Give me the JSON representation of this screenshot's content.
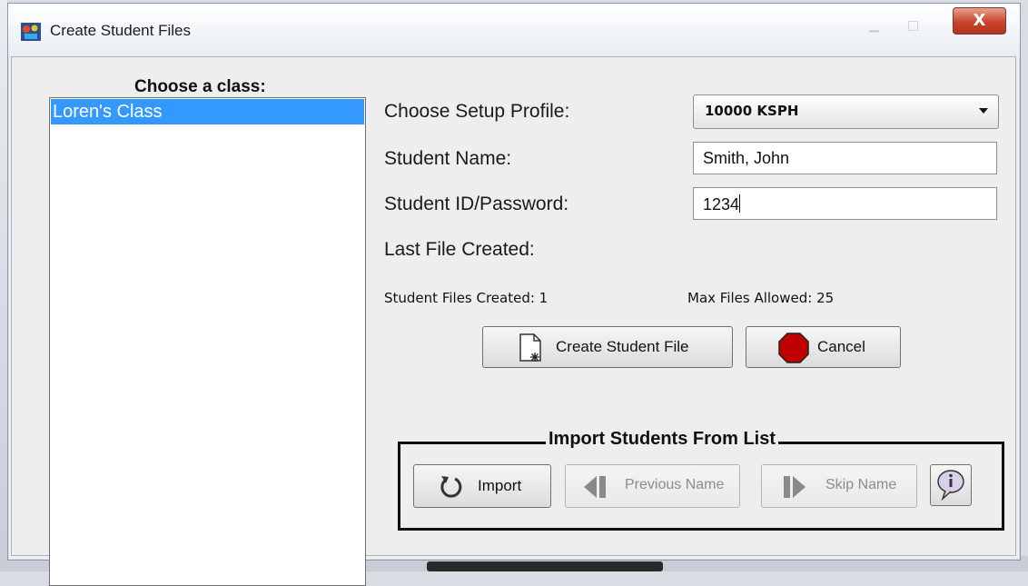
{
  "window": {
    "title": "Create Student Files",
    "close_label": "X"
  },
  "class_panel": {
    "title": "Choose a class:",
    "items": [
      "Loren's Class"
    ]
  },
  "form": {
    "setup_profile_label": "Choose Setup Profile:",
    "setup_profile_value": "10000 KSPH",
    "student_name_label": "Student Name:",
    "student_name_value": "Smith, John",
    "student_id_label": "Student ID/Password:",
    "student_id_value": "1234",
    "last_file_label": "Last File Created:",
    "files_created_text": "Student Files Created: 1",
    "max_files_text": "Max Files Allowed: 25"
  },
  "actions": {
    "create_label": "Create Student File",
    "cancel_label": "Cancel"
  },
  "import_group": {
    "title": "Import Students From List",
    "import_label": "Import",
    "previous_label": "Previous Name",
    "skip_label": "Skip Name"
  },
  "colors": {
    "selection": "#3399ff",
    "stop_sign": "#c00000",
    "close_button": "#c9442d"
  }
}
